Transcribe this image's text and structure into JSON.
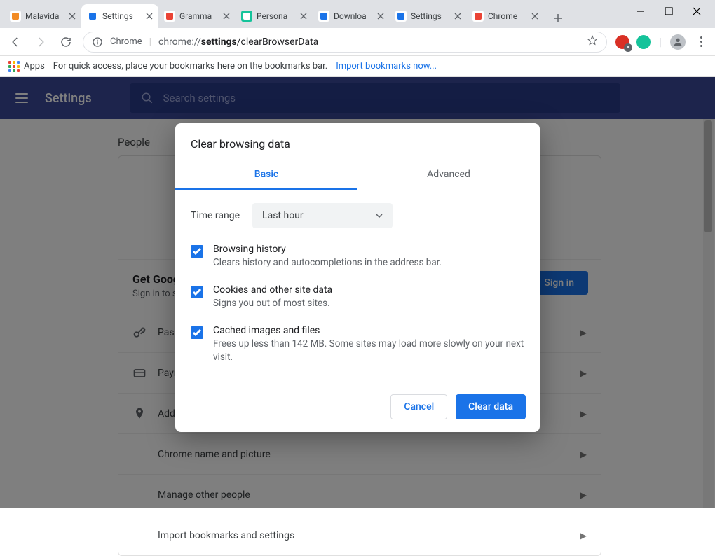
{
  "window": {
    "title": "Settings"
  },
  "tabs": [
    {
      "title": "Malavida",
      "active": false,
      "favicon_bg": "#ffffff",
      "favicon_fg": "#f28b24"
    },
    {
      "title": "Settings",
      "active": true,
      "favicon_bg": "#ffffff",
      "favicon_fg": "#1a73e8"
    },
    {
      "title": "Gramma",
      "active": false,
      "favicon_bg": "#ffffff",
      "favicon_fg": "#ea4335"
    },
    {
      "title": "Persona",
      "active": false,
      "favicon_bg": "#15c39a",
      "favicon_fg": "#ffffff"
    },
    {
      "title": "Downloa",
      "active": false,
      "favicon_bg": "#ffffff",
      "favicon_fg": "#1a73e8"
    },
    {
      "title": "Settings",
      "active": false,
      "favicon_bg": "#ffffff",
      "favicon_fg": "#1a73e8"
    },
    {
      "title": "Chrome",
      "active": false,
      "favicon_bg": "#ffffff",
      "favicon_fg": "#ea4335"
    }
  ],
  "toolbar": {
    "secure_label": "Chrome",
    "url_scheme": "chrome://",
    "url_host": "settings",
    "url_path": "/clearBrowserData"
  },
  "extensions": [
    {
      "name": "extension-1",
      "color": "#d93025",
      "badge": "×"
    },
    {
      "name": "grammarly",
      "color": "#15c39a",
      "badge": ""
    }
  ],
  "bookmark_bar": {
    "apps_label": "Apps",
    "hint_text": "For quick access, place your bookmarks here on the bookmarks bar.",
    "link_text": "Import bookmarks now..."
  },
  "grid_colors": [
    "#ea4335",
    "#fbbc04",
    "#4285f4",
    "#34a853",
    "#ea4335",
    "#fbbc04",
    "#4285f4",
    "#34a853",
    "#ea4335"
  ],
  "settings_page": {
    "app_title": "Settings",
    "search_placeholder": "Search settings",
    "section": "People",
    "signin_heading": "Get Google smarts in Chrome",
    "signin_sub": "Sign in to sync and personalize Chrome across your devices",
    "signin_button": "Sign in",
    "rows": [
      {
        "icon": "key",
        "label": "Passwords"
      },
      {
        "icon": "card",
        "label": "Payment methods"
      },
      {
        "icon": "pin",
        "label": "Addresses and more"
      },
      {
        "icon": "",
        "label": "Chrome name and picture"
      },
      {
        "icon": "",
        "label": "Manage other people"
      },
      {
        "icon": "",
        "label": "Import bookmarks and settings"
      }
    ]
  },
  "dialog": {
    "title": "Clear browsing data",
    "tab_basic": "Basic",
    "tab_advanced": "Advanced",
    "time_label": "Time range",
    "time_value": "Last hour",
    "options": [
      {
        "title": "Browsing history",
        "sub": "Clears history and autocompletions in the address bar.",
        "checked": true
      },
      {
        "title": "Cookies and other site data",
        "sub": "Signs you out of most sites.",
        "checked": true
      },
      {
        "title": "Cached images and files",
        "sub": "Frees up less than 142 MB. Some sites may load more slowly on your next visit.",
        "checked": true
      }
    ],
    "cancel": "Cancel",
    "confirm": "Clear data"
  }
}
